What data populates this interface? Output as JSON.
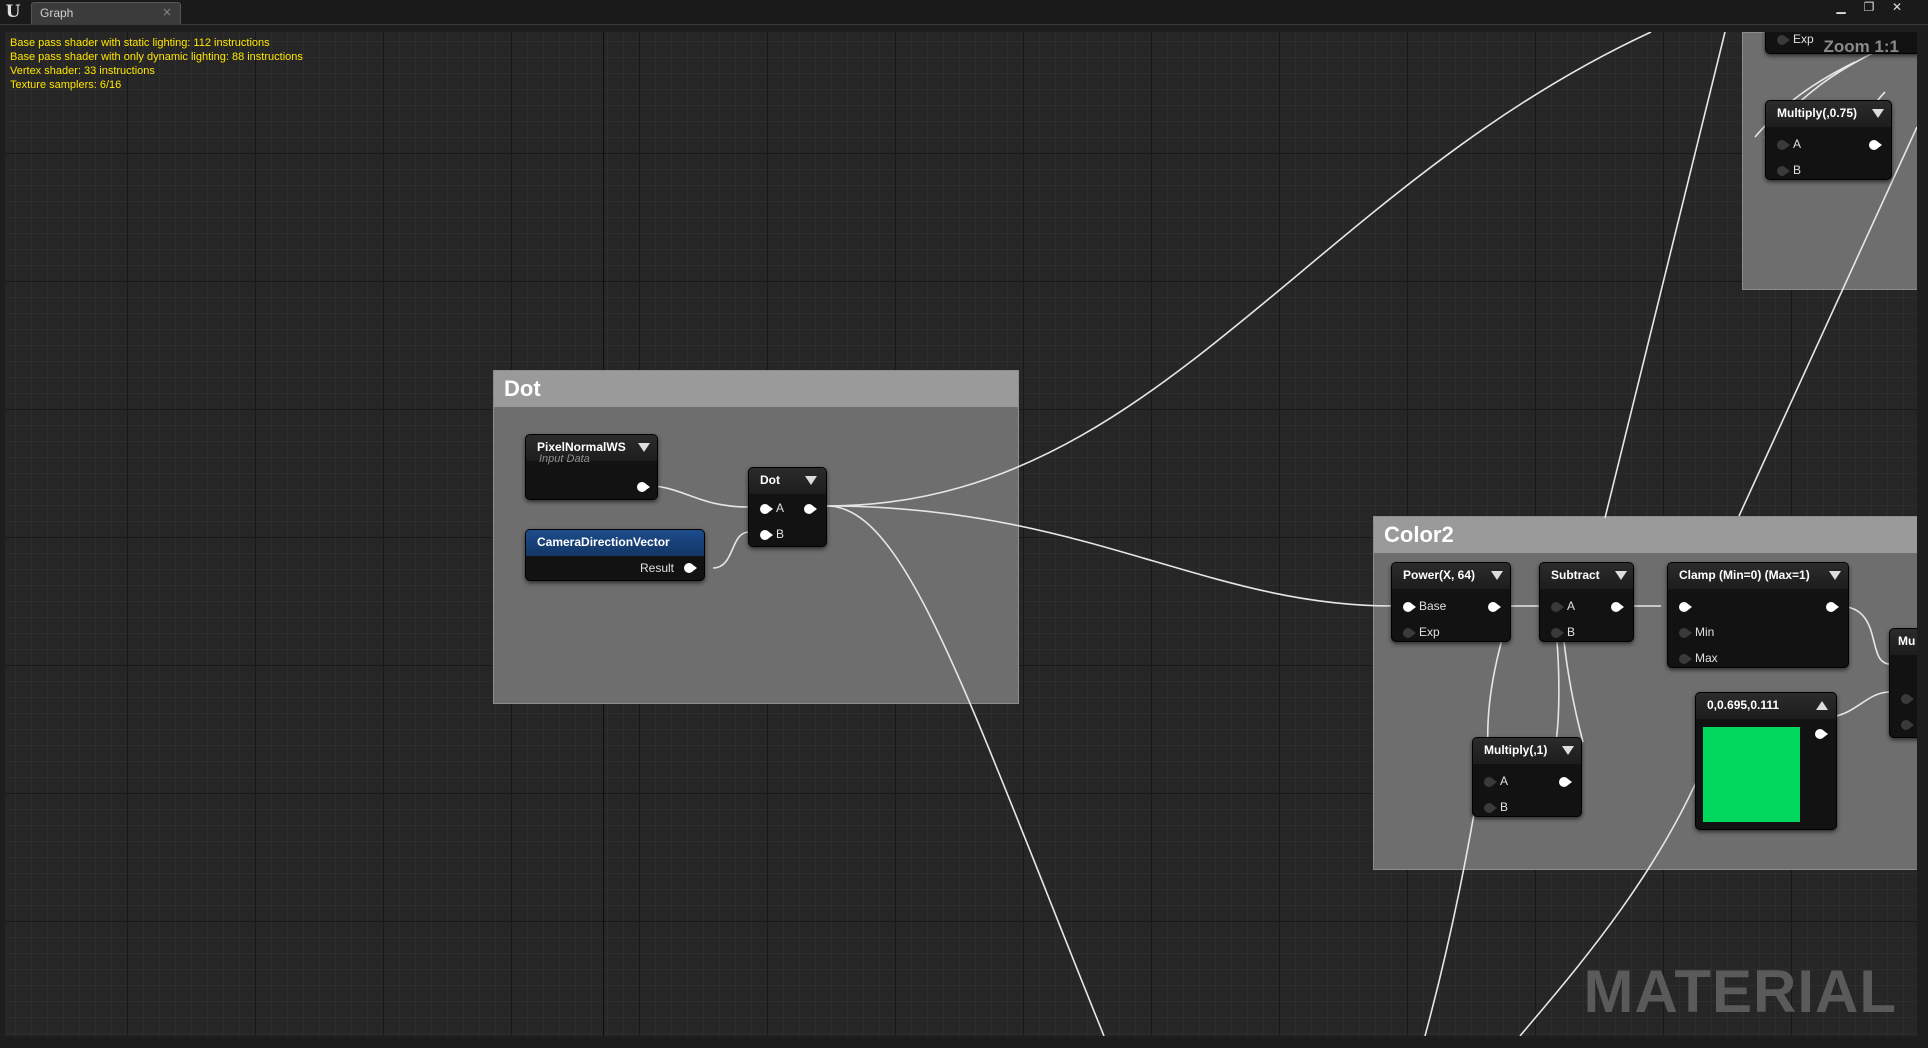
{
  "window": {
    "tab_label": "Graph",
    "tab_close": "×",
    "logo": "U",
    "buttons": {
      "minimize": "▁",
      "restore": "❐",
      "close": "✕"
    }
  },
  "stats": [
    "Base pass shader with static lighting: 112 instructions",
    "Base pass shader with only dynamic lighting: 88 instructions",
    "Vertex shader: 33 instructions",
    "Texture samplers: 6/16"
  ],
  "zoom_label": "Zoom 1:1",
  "watermark": "MATERIAL",
  "comments": {
    "dot": "Dot",
    "color2": "Color2"
  },
  "nodes": {
    "pixel_normal": {
      "title": "PixelNormalWS",
      "subtitle": "Input Data"
    },
    "camera_dir": {
      "title": "CameraDirectionVector",
      "pin_result": "Result"
    },
    "dot": {
      "title": "Dot",
      "pin_a": "A",
      "pin_b": "B"
    },
    "power": {
      "title": "Power(X, 64)",
      "pin_base": "Base",
      "pin_exp": "Exp"
    },
    "subtract": {
      "title": "Subtract",
      "pin_a": "A",
      "pin_b": "B"
    },
    "clamp": {
      "title": "Clamp (Min=0) (Max=1)",
      "pin_min": "Min",
      "pin_max": "Max"
    },
    "multiply1": {
      "title": "Multiply(,1)",
      "pin_a": "A",
      "pin_b": "B"
    },
    "constant": {
      "title": "0,0.695,0.111",
      "color": "#00d95e"
    },
    "multiply075": {
      "title": "Multiply(,0.75)",
      "pin_a": "A",
      "pin_b": "B"
    },
    "top_partial": {
      "pin_exp": "Exp"
    },
    "right_partial": {
      "title": "Mu"
    }
  },
  "colors": {
    "stats_text": "#ffe600",
    "constant_swatch": "#00d95e",
    "blue_header": "#1d4d8c"
  }
}
